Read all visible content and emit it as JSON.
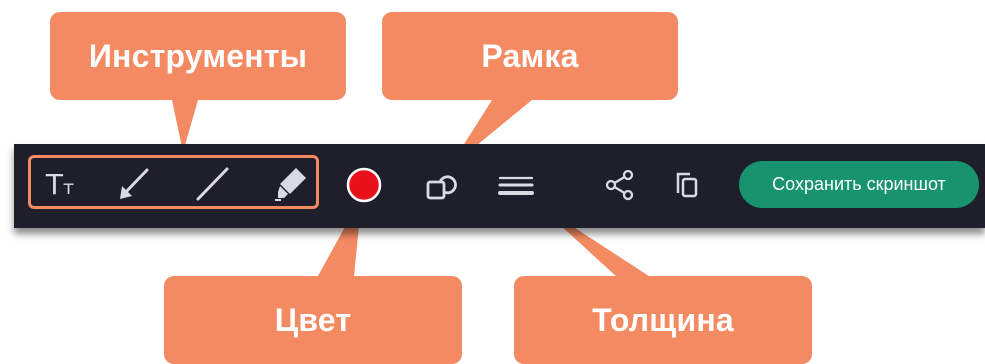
{
  "callouts": {
    "tools": "Инструменты",
    "frame": "Рамка",
    "color": "Цвет",
    "thickness": "Толщина"
  },
  "toolbar": {
    "text_tool_glyph_big": "T",
    "text_tool_glyph_small": "т",
    "text_tool_icon": "text-size-icon",
    "arrow_tool_icon": "arrow-icon",
    "line_tool_icon": "line-icon",
    "marker_tool_icon": "marker-icon",
    "color_icon": "color-swatch-icon",
    "frame_icon": "shapes-icon",
    "thickness_icon": "line-thickness-icon",
    "share_icon": "share-icon",
    "copy_icon": "copy-icon",
    "save_label": "Сохранить скриншот"
  },
  "colors": {
    "callout": "#f38a62",
    "toolbar_bg": "#1e1f2a",
    "icon": "#d9dbe3",
    "selected_color": "#e8101a",
    "save_button": "#17946e"
  }
}
